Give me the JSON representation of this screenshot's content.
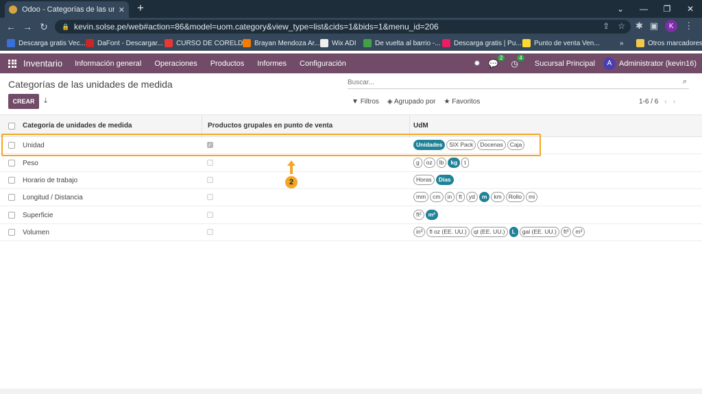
{
  "browser": {
    "tab_title": "Odoo - Categorías de las unidad",
    "url": "kevin.solse.pe/web#action=86&model=uom.category&view_type=list&cids=1&bids=1&menu_id=206",
    "profile_initial": "K",
    "bookmarks": [
      {
        "label": "Descarga gratis Vec...",
        "color": "#3b6fd8"
      },
      {
        "label": "DaFont - Descargar...",
        "color": "#c62828"
      },
      {
        "label": "CURSO DE CORELD...",
        "color": "#e53935"
      },
      {
        "label": "Brayan Mendoza Ar...",
        "color": "#f57c00"
      },
      {
        "label": "Wix ADI",
        "color": "#f0f0f0"
      },
      {
        "label": "De vuelta al barrio -...",
        "color": "#43a047"
      },
      {
        "label": "Descarga gratis | Pu...",
        "color": "#e91e63"
      },
      {
        "label": "Punto de venta Ven...",
        "color": "#fdd835"
      }
    ],
    "other_bookmarks": "Otros marcadores"
  },
  "odoo_nav": {
    "brand": "Inventario",
    "menus": [
      "Información general",
      "Operaciones",
      "Productos",
      "Informes",
      "Configuración"
    ],
    "chat_badge": "2",
    "activity_badge": "4",
    "branch": "Sucursal Principal",
    "user_initial": "A",
    "user": "Administrator (kevin16)"
  },
  "control": {
    "title": "Categorías de las unidades de medida",
    "search_placeholder": "Buscar...",
    "create_label": "CREAR",
    "filters_label": "Filtros",
    "group_label": "Agrupado por",
    "favorites_label": "Favoritos",
    "pager": "1-6 / 6"
  },
  "table": {
    "headers": [
      "Categoría de unidades de medida",
      "Productos grupales en punto de venta",
      "UdM"
    ],
    "rows": [
      {
        "name": "Unidad",
        "pos_group": true,
        "uom": [
          {
            "t": "Unidades",
            "ref": true
          },
          {
            "t": "SIX Pack"
          },
          {
            "t": "Docenas"
          },
          {
            "t": "Caja"
          }
        ]
      },
      {
        "name": "Peso",
        "pos_group": false,
        "uom": [
          {
            "t": "g"
          },
          {
            "t": "oz"
          },
          {
            "t": "lb"
          },
          {
            "t": "kg",
            "ref": true
          },
          {
            "t": "t"
          }
        ]
      },
      {
        "name": "Horario de trabajo",
        "pos_group": false,
        "uom": [
          {
            "t": "Horas"
          },
          {
            "t": "Días",
            "ref": true
          }
        ]
      },
      {
        "name": "Longitud / Distancia",
        "pos_group": false,
        "uom": [
          {
            "t": "mm"
          },
          {
            "t": "cm"
          },
          {
            "t": "in"
          },
          {
            "t": "ft"
          },
          {
            "t": "yd"
          },
          {
            "t": "m",
            "ref": true
          },
          {
            "t": "km"
          },
          {
            "t": "Rollo"
          },
          {
            "t": "mi"
          }
        ]
      },
      {
        "name": "Superficie",
        "pos_group": false,
        "uom": [
          {
            "t": "ft²"
          },
          {
            "t": "m²",
            "ref": true
          }
        ]
      },
      {
        "name": "Volumen",
        "pos_group": false,
        "uom": [
          {
            "t": "in³"
          },
          {
            "t": "fl oz (EE. UU.)"
          },
          {
            "t": "qt (EE. UU.)"
          },
          {
            "t": "L",
            "ref": true
          },
          {
            "t": "gal (EE. UU.)"
          },
          {
            "t": "ft³"
          },
          {
            "t": "m³"
          }
        ]
      }
    ]
  },
  "annotation": {
    "step_number": "2",
    "color": "#f5a623"
  }
}
